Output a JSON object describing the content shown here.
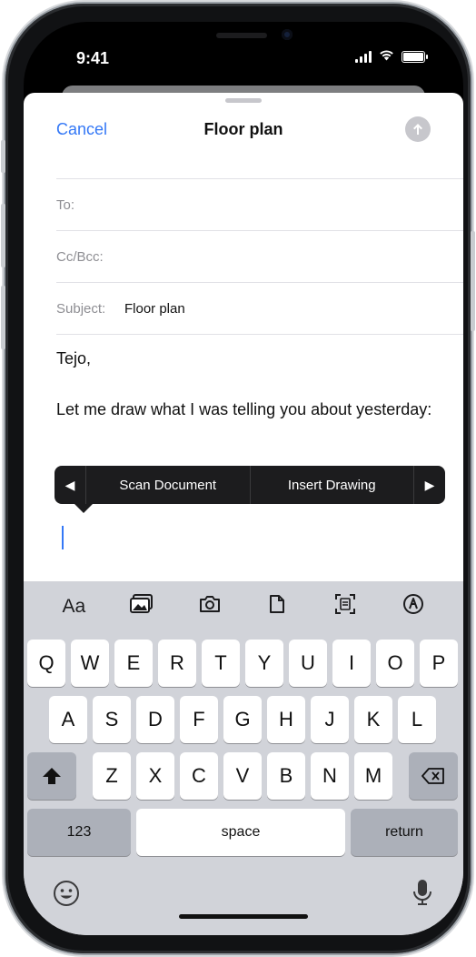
{
  "status": {
    "time": "9:41"
  },
  "compose": {
    "cancel_label": "Cancel",
    "title": "Floor plan",
    "to_label": "To:",
    "cc_label": "Cc/Bcc:",
    "subject_label": "Subject:",
    "subject_value": "Floor plan",
    "body_greeting": "Tejo,",
    "body_text": "Let me draw what I was telling you about yesterday:"
  },
  "popover": {
    "items": [
      "Scan Document",
      "Insert Drawing"
    ]
  },
  "keyboard": {
    "toolbar": [
      "text-format-icon",
      "photo-library-icon",
      "camera-icon",
      "file-icon",
      "scan-icon",
      "markup-icon"
    ],
    "format_label": "Aa",
    "row1": [
      "Q",
      "W",
      "E",
      "R",
      "T",
      "Y",
      "U",
      "I",
      "O",
      "P"
    ],
    "row2": [
      "A",
      "S",
      "D",
      "F",
      "G",
      "H",
      "J",
      "K",
      "L"
    ],
    "row3": [
      "Z",
      "X",
      "C",
      "V",
      "B",
      "N",
      "M"
    ],
    "numbers_label": "123",
    "space_label": "space",
    "return_label": "return"
  },
  "colors": {
    "accent": "#3478f6",
    "keyboard_bg": "#d1d3d9",
    "popover_bg": "#1c1c1e"
  }
}
